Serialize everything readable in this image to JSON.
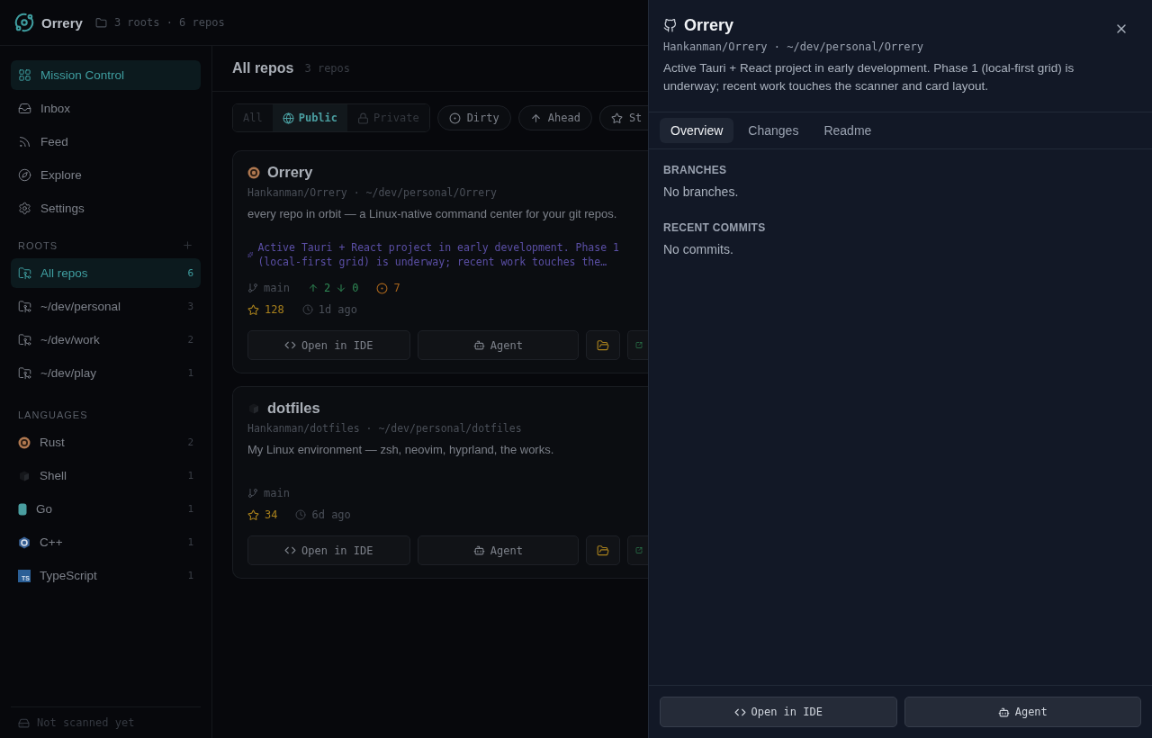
{
  "app": {
    "name": "Orrery",
    "summary": "3 roots · 6 repos"
  },
  "sidebar": {
    "nav": [
      {
        "label": "Mission Control",
        "kind": "grid",
        "selected": true
      },
      {
        "label": "Inbox",
        "kind": "inbox",
        "selected": false
      },
      {
        "label": "Feed",
        "kind": "feed",
        "selected": false
      },
      {
        "label": "Explore",
        "kind": "explore",
        "selected": false
      },
      {
        "label": "Settings",
        "kind": "settings",
        "selected": false
      }
    ],
    "roots_heading": "ROOTS",
    "roots": [
      {
        "label": "All repos",
        "count": "6",
        "selected": true
      },
      {
        "label": "~/dev/personal",
        "count": "3",
        "selected": false
      },
      {
        "label": "~/dev/work",
        "count": "2",
        "selected": false
      },
      {
        "label": "~/dev/play",
        "count": "1",
        "selected": false
      }
    ],
    "languages_heading": "LANGUAGES",
    "languages": [
      {
        "label": "Rust",
        "count": "2",
        "kind": "rust"
      },
      {
        "label": "Shell",
        "count": "1",
        "kind": "shell"
      },
      {
        "label": "Go",
        "count": "1",
        "kind": "go"
      },
      {
        "label": "C++",
        "count": "1",
        "kind": "cpp"
      },
      {
        "label": "TypeScript",
        "count": "1",
        "kind": "typescript",
        "badge": "TS"
      }
    ],
    "status": "Not scanned yet"
  },
  "main": {
    "title": "All repos",
    "count": "3 repos",
    "visibility": [
      {
        "label": "All",
        "kind": "all",
        "selected": false
      },
      {
        "label": "Public",
        "kind": "public",
        "selected": true
      },
      {
        "label": "Private",
        "kind": "private",
        "selected": false
      }
    ],
    "chips": [
      {
        "label": "Dirty",
        "kind": "dirty"
      },
      {
        "label": "Ahead",
        "kind": "ahead"
      },
      {
        "label": "St",
        "kind": "starred"
      }
    ],
    "repos": [
      {
        "name": "Orrery",
        "kind": "rust",
        "path": "Hankanman/Orrery · ~/dev/personal/Orrery",
        "description": "every repo in orbit — a Linux-native command center for your git repos.",
        "ai_summary": "Active Tauri + React project in early development. Phase 1 (local-first grid) is underway; recent work touches the…",
        "branch": "main",
        "ahead": "2",
        "behind": "0",
        "dirty": "7",
        "stars": "128",
        "updated": "1d ago",
        "actions": [
          "Open in IDE",
          "Agent"
        ]
      },
      {
        "name": "dotfiles",
        "kind": "shell",
        "path": "Hankanman/dotfiles · ~/dev/personal/dotfiles",
        "description": "My Linux environment — zsh, neovim, hyprland, the works.",
        "branch": "main",
        "stars": "34",
        "updated": "6d ago",
        "actions": [
          "Open in IDE",
          "Agent"
        ]
      }
    ]
  },
  "drawer": {
    "title": "Orrery",
    "path": "Hankanman/Orrery · ~/dev/personal/Orrery",
    "summary": "Active Tauri + React project in early development. Phase 1 (local-first grid) is underway; recent work touches the scanner and card layout.",
    "tabs": [
      {
        "label": "Overview",
        "selected": true
      },
      {
        "label": "Changes",
        "selected": false
      },
      {
        "label": "Readme",
        "selected": false
      }
    ],
    "sections": [
      {
        "heading": "BRANCHES",
        "empty": "No branches."
      },
      {
        "heading": "RECENT COMMITS",
        "empty": "No commits."
      }
    ],
    "actions": [
      "Open in IDE",
      "Agent"
    ]
  }
}
